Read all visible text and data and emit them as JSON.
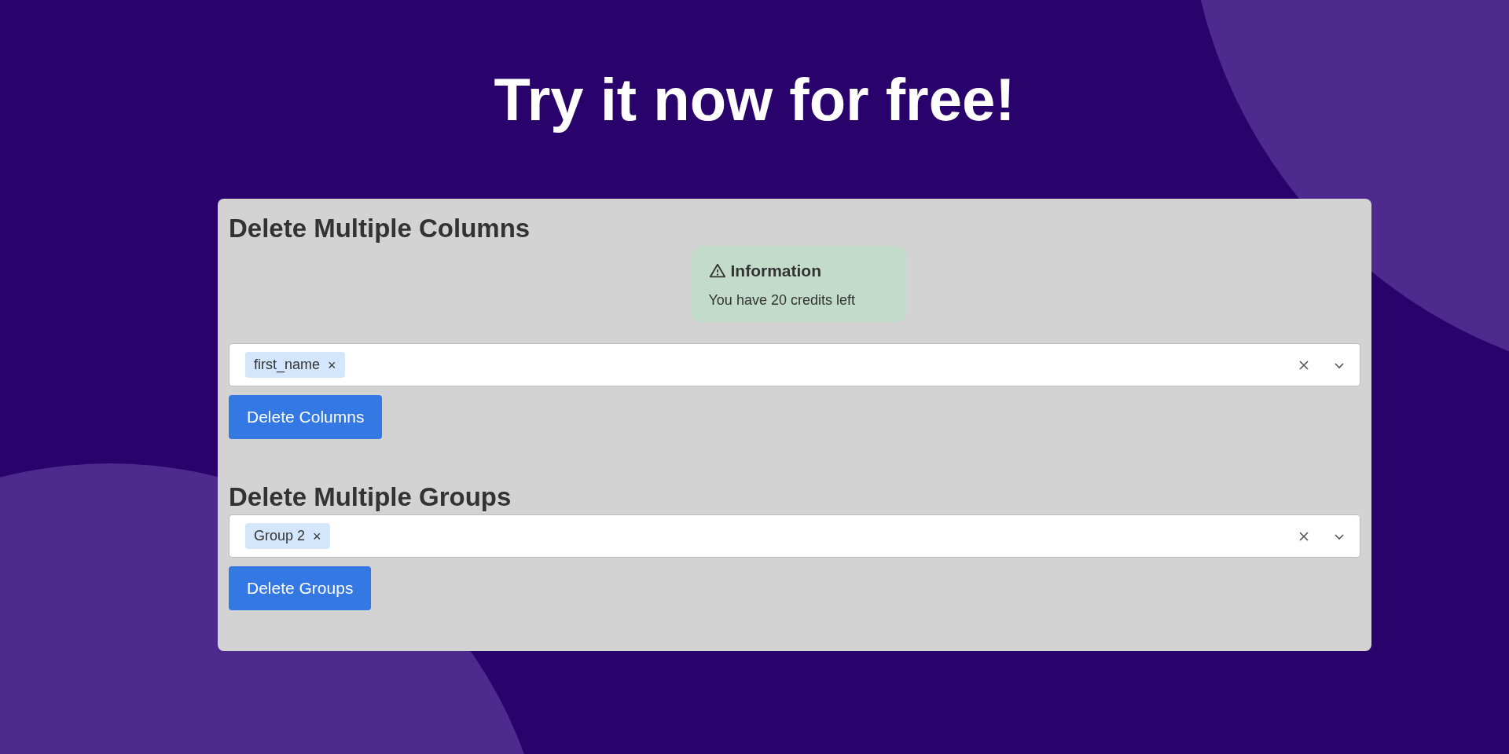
{
  "headline": "Try it now for free!",
  "sections": [
    {
      "heading": "Delete Multiple Columns",
      "info": {
        "title": "Information",
        "text": "You have 20 credits left"
      },
      "tags": [
        {
          "label": "first_name",
          "remove": "×"
        }
      ],
      "button": "Delete Columns"
    },
    {
      "heading": "Delete Multiple Groups",
      "tags": [
        {
          "label": "Group 2",
          "remove": "×"
        }
      ],
      "button": "Delete Groups"
    }
  ]
}
